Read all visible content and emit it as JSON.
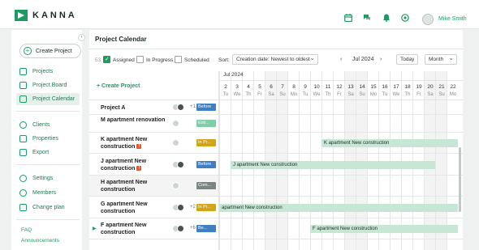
{
  "app": {
    "brand": "KANNA",
    "user": "Mike Smith"
  },
  "topbar_icons": [
    "calendar-icon",
    "chat-icon",
    "bell-icon",
    "help-icon"
  ],
  "sidebar": {
    "create_label": "Create Project",
    "groups": [
      [
        {
          "label": "Projects",
          "icon": "projects-icon"
        },
        {
          "label": "Project Board",
          "icon": "board-icon"
        },
        {
          "label": "Project Calendar",
          "icon": "calendar-icon",
          "active": true
        }
      ],
      [
        {
          "label": "Clients",
          "icon": "clients-icon"
        },
        {
          "label": "Properties",
          "icon": "properties-icon"
        },
        {
          "label": "Export",
          "icon": "export-icon"
        }
      ],
      [
        {
          "label": "Settings",
          "icon": "gear-icon"
        },
        {
          "label": "Members",
          "icon": "members-icon"
        },
        {
          "label": "Change plan",
          "icon": "plan-icon"
        }
      ]
    ],
    "links": [
      "FAQ",
      "Announcements"
    ]
  },
  "page": {
    "title": "Project Calendar"
  },
  "toolbar": {
    "count": "53",
    "filters": [
      {
        "label": "Assigned",
        "checked": true
      },
      {
        "label": "In Progress",
        "checked": false
      },
      {
        "label": "Scheduled",
        "checked": false
      }
    ],
    "sort_label": "Sort:",
    "sort_value": "Creation date: Newest to oldest",
    "current_month": "Jul 2024",
    "today_label": "Today",
    "view_value": "Month"
  },
  "calendar": {
    "create_label": "+ Create Project",
    "month_label": "Jul 2024",
    "days": [
      {
        "d": "2",
        "w": "Tu"
      },
      {
        "d": "3",
        "w": "We"
      },
      {
        "d": "4",
        "w": "Th"
      },
      {
        "d": "5",
        "w": "Fr"
      },
      {
        "d": "6",
        "w": "Sa"
      },
      {
        "d": "7",
        "w": "Su"
      },
      {
        "d": "8",
        "w": "Mo"
      },
      {
        "d": "9",
        "w": "Tu"
      },
      {
        "d": "10",
        "w": "We"
      },
      {
        "d": "11",
        "w": "Th"
      },
      {
        "d": "12",
        "w": "Fr"
      },
      {
        "d": "13",
        "w": "Sa"
      },
      {
        "d": "14",
        "w": "Su"
      },
      {
        "d": "15",
        "w": "Mo"
      },
      {
        "d": "16",
        "w": "Tu"
      },
      {
        "d": "17",
        "w": "We"
      },
      {
        "d": "18",
        "w": "Th"
      },
      {
        "d": "19",
        "w": "Fr"
      },
      {
        "d": "20",
        "w": "Sa"
      },
      {
        "d": "21",
        "w": "Su"
      },
      {
        "d": "22",
        "w": "Mo"
      }
    ],
    "projects": [
      {
        "name": "Project A",
        "warn": false,
        "avatars": 2,
        "extra": "+1",
        "status": "Before",
        "color": "blue",
        "bar": null
      },
      {
        "name": "M apartment renovation",
        "warn": false,
        "avatars": 1,
        "extra": "",
        "status": "Esti...",
        "color": "green",
        "bar": null
      },
      {
        "name": "K apartment New construction",
        "warn": true,
        "avatars": 1,
        "extra": "",
        "status": "In Pr...",
        "color": "gold",
        "bar": {
          "label": "K apartment New construction",
          "start": "11",
          "end": "22"
        }
      },
      {
        "name": "J apartment New construction",
        "warn": true,
        "avatars": 2,
        "extra": "",
        "status": "Before",
        "color": "blue",
        "bar": {
          "label": "J apartment New construction",
          "start": "3",
          "end": "20"
        }
      },
      {
        "name": "H apartment New construction",
        "warn": false,
        "avatars": 1,
        "extra": "",
        "status": "Com...",
        "color": "gray",
        "bar": null,
        "highlight": true
      },
      {
        "name": "G apartment New construction",
        "warn": false,
        "avatars": 2,
        "extra": "+2",
        "status": "In Pr...",
        "color": "gold",
        "bar": {
          "label": "apartment New construction",
          "start": "2",
          "end": "22"
        }
      },
      {
        "name": "F apartment New construction",
        "warn": false,
        "avatars": 2,
        "extra": "+6",
        "status": "Be...",
        "color": "blue",
        "bar": {
          "label": "F apartment New construction",
          "start": "10",
          "end": "22"
        },
        "expand": true
      }
    ]
  }
}
